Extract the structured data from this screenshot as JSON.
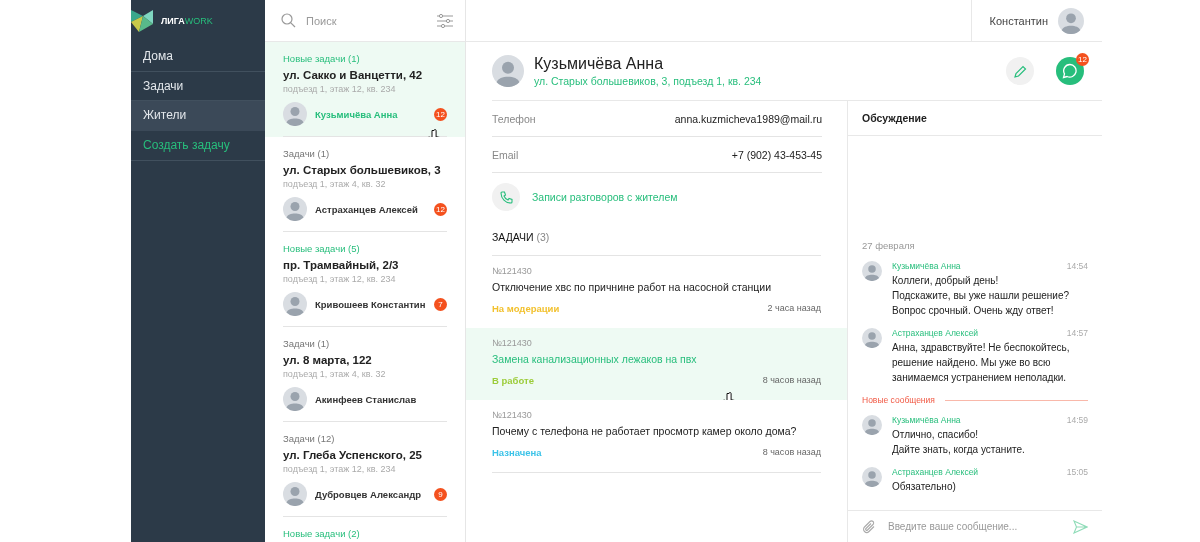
{
  "logo": {
    "main": "ЛИГА",
    "accent": "WORK"
  },
  "sidebar": {
    "items": [
      {
        "label": "Дома",
        "selected": false,
        "kind": "nav"
      },
      {
        "label": "Задачи",
        "selected": false,
        "kind": "nav"
      },
      {
        "label": "Жители",
        "selected": true,
        "kind": "nav"
      },
      {
        "label": "Создать задачу",
        "selected": false,
        "kind": "action"
      }
    ]
  },
  "search": {
    "placeholder": "Поиск"
  },
  "user": {
    "name": "Константин"
  },
  "residents": [
    {
      "group": "Новые задачи (1)",
      "kind": "new",
      "title": "ул. Сакко и Ванцетти, 42",
      "subtitle": "подъезд 1, этаж 12, кв. 234",
      "person": "Кузьмичёва Анна",
      "badge": "12",
      "selected": true
    },
    {
      "group": "Задачи (1)",
      "kind": "normal",
      "title": "ул. Старых большевиков, 3",
      "subtitle": "подъезд 1, этаж 4, кв. 32",
      "person": "Астраханцев Алексей",
      "badge": "12",
      "selected": false
    },
    {
      "group": "Новые задачи (5)",
      "kind": "new",
      "title": "пр. Трамвайный, 2/3",
      "subtitle": "подъезд 1, этаж 12, кв. 234",
      "person": "Кривошеев Константин",
      "badge": "7",
      "selected": false
    },
    {
      "group": "Задачи (1)",
      "kind": "normal",
      "title": "ул. 8 марта, 122",
      "subtitle": "подъезд 1, этаж 4, кв. 32",
      "person": "Акинфеев Станислав",
      "selected": false
    },
    {
      "group": "Задачи (12)",
      "kind": "normal",
      "title": "ул. Глеба Успенского, 25",
      "subtitle": "подъезд 1, этаж 12, кв. 234",
      "person": "Дубровцев Александр",
      "badge": "9",
      "selected": false
    },
    {
      "group": "Новые задачи (2)",
      "kind": "new",
      "selected": false
    }
  ],
  "profile": {
    "name": "Кузьмичёва Анна",
    "address": "ул. Старых большевиков, 3, подъезд 1, кв. 234",
    "chat_badge": "12"
  },
  "fields": [
    {
      "label": "Телефон",
      "value": "anna.kuzmicheva1989@mail.ru"
    },
    {
      "label": "Email",
      "value": "+7 (902) 43-453-45"
    }
  ],
  "call_records": "Записи разговоров с жителем",
  "tasks_heading": {
    "title": "ЗАДАЧИ",
    "count": "(3)"
  },
  "tasks": [
    {
      "number": "№121430",
      "title": "Отключение хвс по причнине работ на насосной станции",
      "status": "На модерации",
      "color": "#f2c12e",
      "time": "2 часа назад",
      "selected": false
    },
    {
      "number": "№121430",
      "title": "Замена канализационных лежаков на пвх",
      "status": "В работе",
      "color": "#9ccc3a",
      "time": "8 часов назад",
      "selected": true
    },
    {
      "number": "№121430",
      "title": "Почему с телефона не работает просмотр камер около дома?",
      "status": "Назначена",
      "color": "#3cc3e8",
      "time": "8 часов назад",
      "selected": false
    }
  ],
  "chat": {
    "title": "Обсуждение",
    "date": "27 февраля",
    "placeholder": "Введите ваше сообщение...",
    "items": [
      {
        "kind": "message",
        "author": "Кузьмичёва Анна",
        "time": "14:54",
        "text": "Коллеги, добрый день!\nПодскажите, вы уже нашли решение?\nВопрос срочный. Очень жду ответ!"
      },
      {
        "kind": "message",
        "author": "Астраханцев Алексей",
        "time": "14:57",
        "text": "Анна, здравствуйте! Не беспокойтесь, решение найдено. Мы уже во всю занимаемся устранением неполадки."
      },
      {
        "kind": "divider",
        "label": "Новые сообщения"
      },
      {
        "kind": "message",
        "author": "Кузьмичёва Анна",
        "time": "14:59",
        "text": "Отлично, спасибо!\nДайте знать, когда устаните."
      },
      {
        "kind": "message",
        "author": "Астраханцев Алексей",
        "time": "15:05",
        "text": "Обязательно)"
      }
    ]
  }
}
